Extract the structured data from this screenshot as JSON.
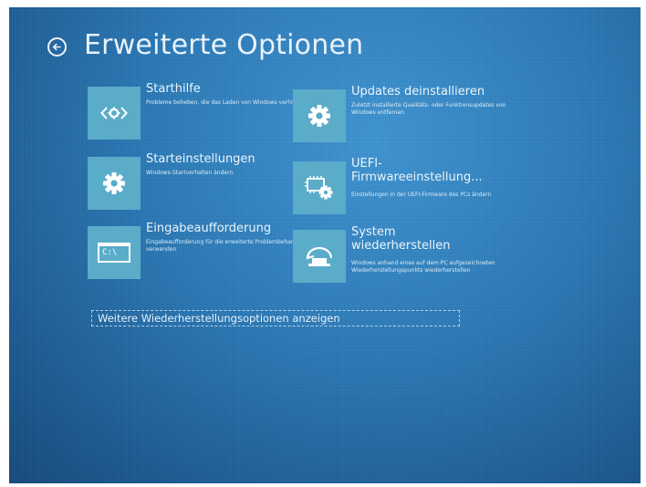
{
  "header": {
    "title": "Erweiterte Optionen",
    "back_icon": "back-arrow-circle-icon"
  },
  "tiles": [
    {
      "title": "Starthilfe",
      "description": "Probleme beheben, die das Laden von Windows verhindern",
      "icon": "startup-repair-icon"
    },
    {
      "title": "Updates deinstallieren",
      "description": "Zuletzt installierte Qualitäts- oder Funktionsupdates von Windows entfernen",
      "icon": "gear-icon"
    },
    {
      "title": "Starteinstellungen",
      "description": "Windows-Startverhalten ändern",
      "icon": "gear-icon"
    },
    {
      "title": "UEFI-Firmwareeinstellung...",
      "description": "Einstellungen in der UEFI-Firmware des PCs ändern",
      "icon": "uefi-firmware-icon"
    },
    {
      "title": "Eingabeaufforderung",
      "description": "Eingabeaufforderung für die erweiterte Problembehandlung verwenden",
      "icon": "command-prompt-icon",
      "icon_text": "C:\\"
    },
    {
      "title": "System wiederherstellen",
      "description": "Windows anhand eines auf dem PC aufgezeichneten Wiederherstellungspunkts wiederherstellen",
      "icon": "system-restore-icon"
    }
  ],
  "more_options": {
    "label": "Weitere Wiederherstellungsoptionen anzeigen"
  },
  "colors": {
    "background": "#2b78b4",
    "tile_icon": "#5aacc9",
    "text": "#eaf4fb"
  }
}
